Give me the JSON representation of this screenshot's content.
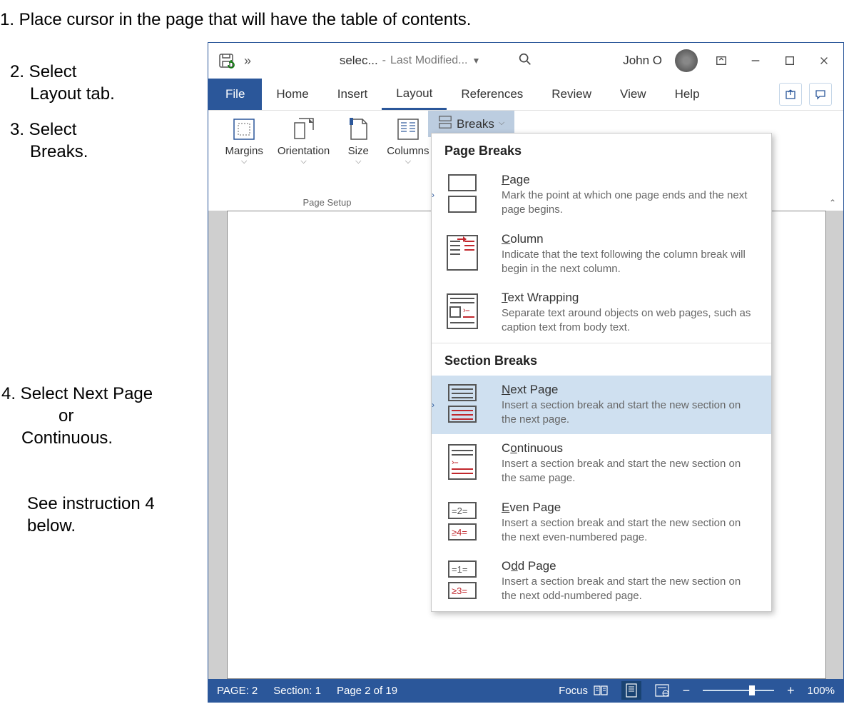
{
  "instructions": {
    "step1": "1. Place cursor in the page that will have the table of contents.",
    "step2a": "2. Select",
    "step2b": "Layout tab.",
    "step3a": "3. Select",
    "step3b": "Breaks.",
    "step4a": "4. Select Next Page",
    "step4b": "or",
    "step4c": "Continuous.",
    "step5a": "See instruction 4",
    "step5b": "below."
  },
  "titlebar": {
    "doc_name": "selec...",
    "dash": "-",
    "modified": "Last Modified...",
    "user": "John O"
  },
  "tabs": {
    "file": "File",
    "home": "Home",
    "insert": "Insert",
    "layout": "Layout",
    "references": "References",
    "review": "Review",
    "view": "View",
    "help": "Help"
  },
  "ribbon": {
    "margins": "Margins",
    "orientation": "Orientation",
    "size": "Size",
    "columns": "Columns",
    "group_label": "Page Setup",
    "breaks_btn": "Breaks"
  },
  "breaks_menu": {
    "page_breaks_header": "Page Breaks",
    "section_breaks_header": "Section Breaks",
    "page": {
      "title_u": "P",
      "title_rest": "age",
      "desc": "Mark the point at which one page ends and the next page begins."
    },
    "column": {
      "title_u": "C",
      "title_rest": "olumn",
      "desc": "Indicate that the text following the column break will begin in the next column."
    },
    "text_wrapping": {
      "title_u": "T",
      "title_rest": "ext Wrapping",
      "desc": "Separate text around objects on web pages, such as caption text from body text."
    },
    "next_page": {
      "title_u": "N",
      "title_rest": "ext Page",
      "desc": "Insert a section break and start the new section on the next page."
    },
    "continuous": {
      "title_pre": "C",
      "title_u": "o",
      "title_rest": "ntinuous",
      "desc": "Insert a section break and start the new section on the same page."
    },
    "even_page": {
      "title_u": "E",
      "title_rest": "ven Page",
      "desc": "Insert a section break and start the new section on the next even-numbered page."
    },
    "odd_page": {
      "title_pre": "O",
      "title_u": "d",
      "title_rest": "d Page",
      "desc": "Insert a section break and start the new section on the next odd-numbered page."
    }
  },
  "status": {
    "page_label": "PAGE: 2",
    "section": "Section: 1",
    "page_count": "Page 2 of 19",
    "focus": "Focus",
    "zoom": "100%"
  }
}
